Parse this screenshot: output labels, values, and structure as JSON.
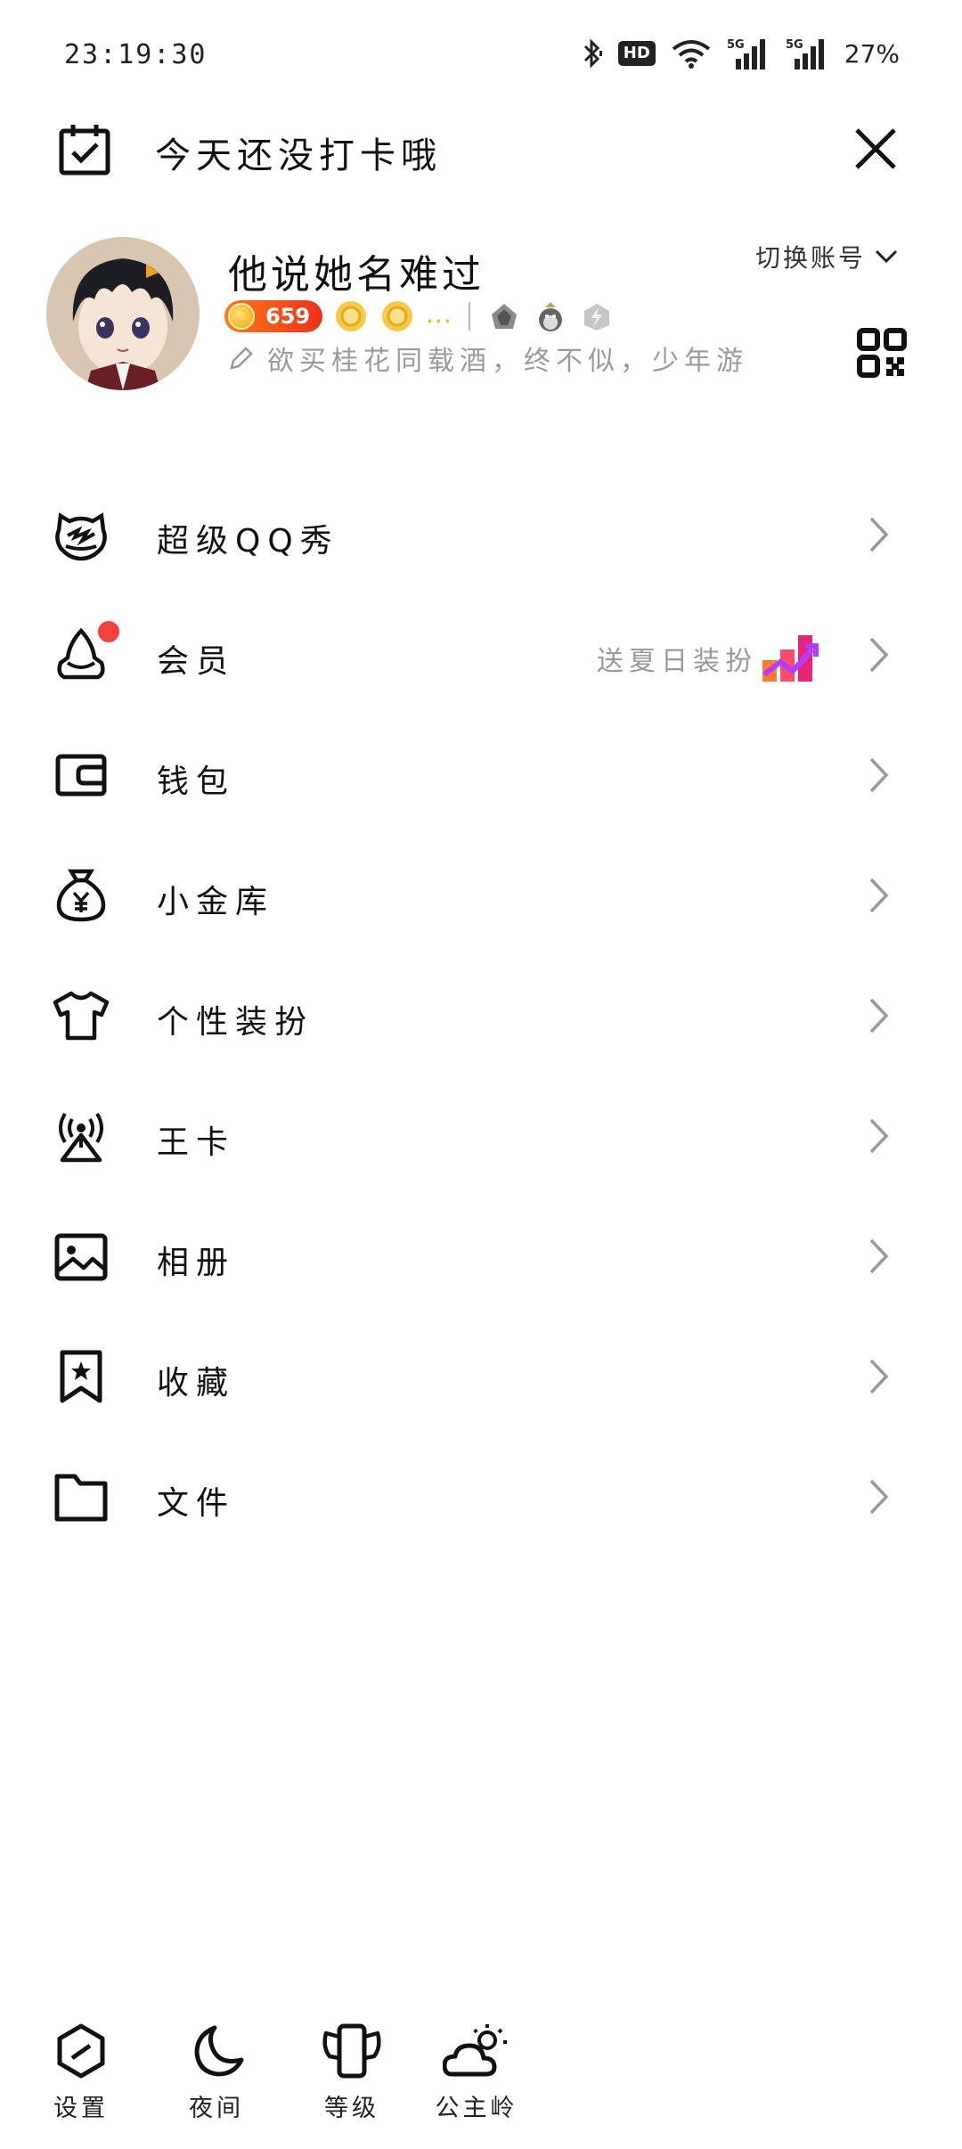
{
  "status_bar": {
    "time": "23:19:30",
    "battery": "27%"
  },
  "checkin": {
    "text": "今天还没打卡哦"
  },
  "profile": {
    "nickname": "他说她名难过",
    "switch_account": "切换账号",
    "level": "659",
    "more": "...",
    "signature": "欲买桂花同载酒，终不似，少年游"
  },
  "menu": {
    "items": [
      {
        "label": "超级QQ秀",
        "icon": "qq-show-icon"
      },
      {
        "label": "会员",
        "icon": "vip-icon",
        "sub": "送夏日装扮"
      },
      {
        "label": "钱包",
        "icon": "wallet-icon"
      },
      {
        "label": "小金库",
        "icon": "money-bag-icon"
      },
      {
        "label": "个性装扮",
        "icon": "tshirt-icon"
      },
      {
        "label": "王卡",
        "icon": "signal-tower-icon"
      },
      {
        "label": "相册",
        "icon": "photo-icon"
      },
      {
        "label": "收藏",
        "icon": "bookmark-star-icon"
      },
      {
        "label": "文件",
        "icon": "folder-icon"
      }
    ]
  },
  "toolbar": {
    "items": [
      {
        "label": "设置",
        "icon": "settings-icon"
      },
      {
        "label": "夜间",
        "icon": "moon-icon"
      },
      {
        "label": "等级",
        "icon": "level-icon"
      },
      {
        "label": "公主岭",
        "icon": "weather-icon"
      }
    ]
  },
  "colors": {
    "accent_red": "#f2423a",
    "level_orange": "#ff7a18",
    "text_secondary": "#999999"
  }
}
